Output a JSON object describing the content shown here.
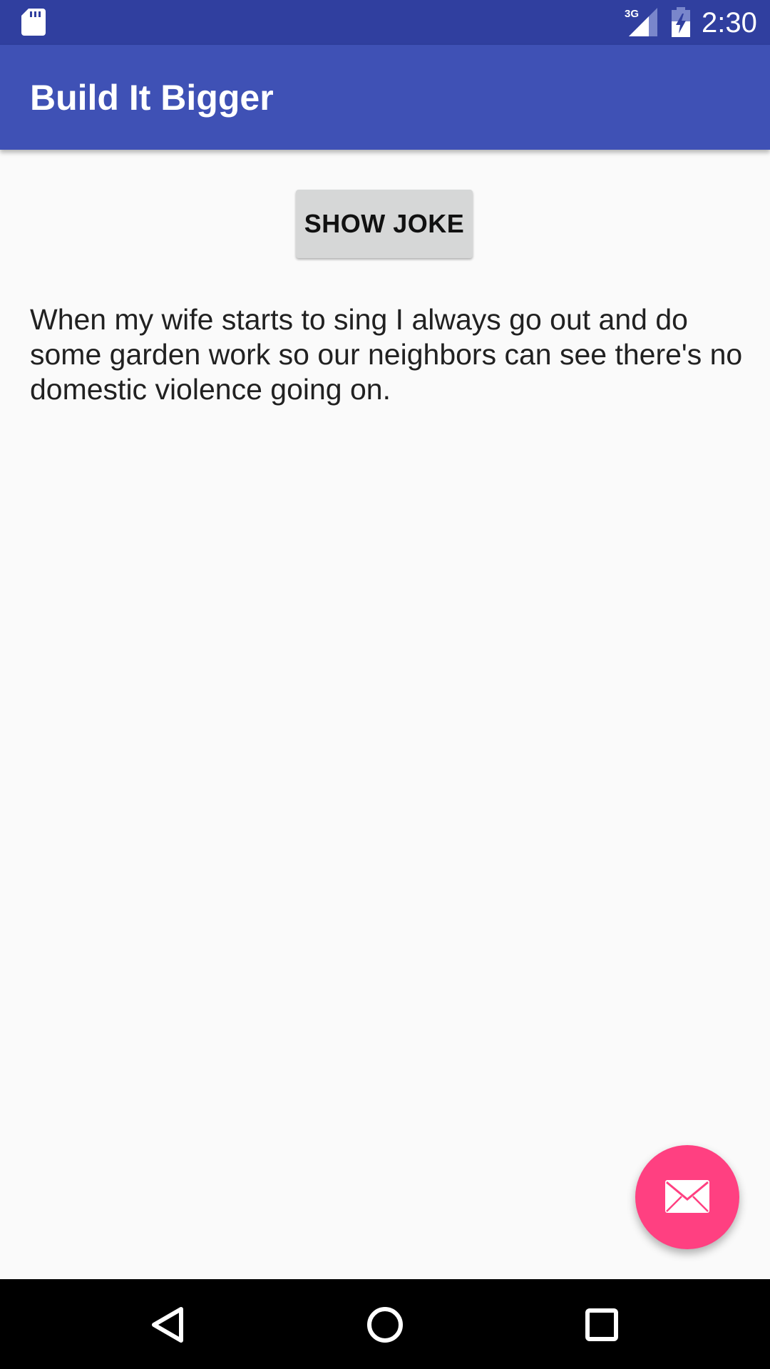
{
  "status_bar": {
    "time": "2:30",
    "network": "3G",
    "icons": [
      "sd-card-icon",
      "signal-icon",
      "battery-charging-icon"
    ]
  },
  "app_bar": {
    "title": "Build It Bigger"
  },
  "main": {
    "show_joke_label": "SHOW JOKE",
    "joke_text": "When my wife starts to sing I always go out and do some garden work so our neighbors can see there's no domestic violence going on."
  },
  "fab": {
    "icon": "email-icon"
  },
  "nav_bar": {
    "icons": [
      "back-icon",
      "home-icon",
      "recents-icon"
    ]
  },
  "colors": {
    "status_bar": "#303f9f",
    "app_bar": "#3f51b5",
    "fab": "#ff4081",
    "background": "#fafafa",
    "button": "#d6d7d7"
  }
}
